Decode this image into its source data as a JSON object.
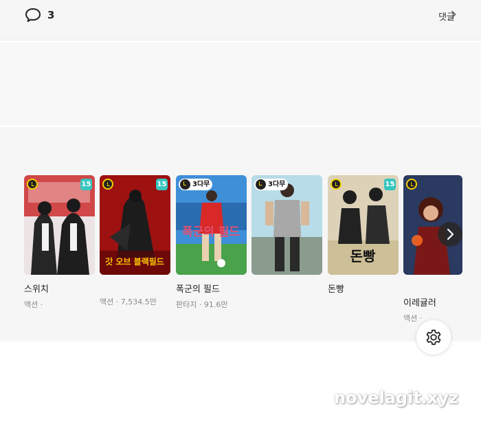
{
  "header": {
    "comment_count": "3",
    "comment_link_label": "댓글"
  },
  "carousel": {
    "items": [
      {
        "title": "스위치",
        "meta": "액션 ·",
        "badge_age": "15",
        "badge_free": ""
      },
      {
        "title": "",
        "meta": "액션 · 7,534.5만",
        "badge_age": "15",
        "badge_free": "",
        "cover_text": "갓 오브 블랙필드"
      },
      {
        "title": "폭군의 필드",
        "meta": "판타지 · 91.6만",
        "badge_age": "",
        "badge_free": "3다무",
        "cover_text": "폭군의 필드"
      },
      {
        "title": "",
        "meta": "",
        "badge_age": "",
        "badge_free": "3다무"
      },
      {
        "title": "돈빵",
        "meta": "",
        "badge_age": "15",
        "badge_free": "",
        "cover_text": "돈빵"
      },
      {
        "title": "이레귤러",
        "meta": "액션 ·",
        "badge_age": "",
        "badge_free": ""
      }
    ]
  },
  "watermark": "novelagit.xyz",
  "colors": {
    "age_badge": "#37c5bf",
    "clock_accent": "#f4d000",
    "section_bg": "#f6f6f6"
  },
  "icons": [
    "comment-icon",
    "chevron-right-icon",
    "clock-icon",
    "gear-icon"
  ]
}
